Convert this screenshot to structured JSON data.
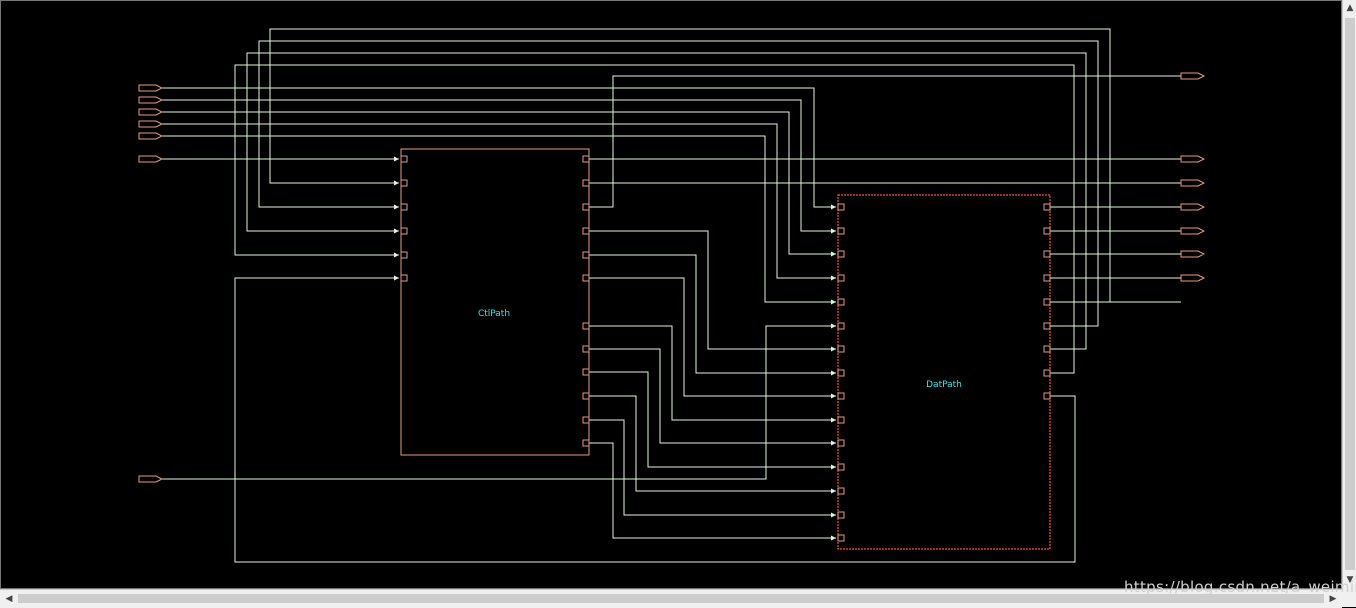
{
  "blocks": {
    "ctl": {
      "label": "CtlPath"
    },
    "dat": {
      "label": "DatPath"
    }
  },
  "watermark": "https://blog.csdn.net/a_weiming",
  "colors": {
    "background": "#000000",
    "block_border": "#e79a80",
    "block_border_selected": "#ff4040",
    "wire": "#dff5dc",
    "wire_faint": "#8a7a9a",
    "pin": "#e79a80",
    "label": "#35e6ee"
  },
  "scrollbar": {
    "up_arrow": "▲",
    "down_arrow": "▼",
    "left_arrow": "◀",
    "right_arrow": "▶"
  }
}
